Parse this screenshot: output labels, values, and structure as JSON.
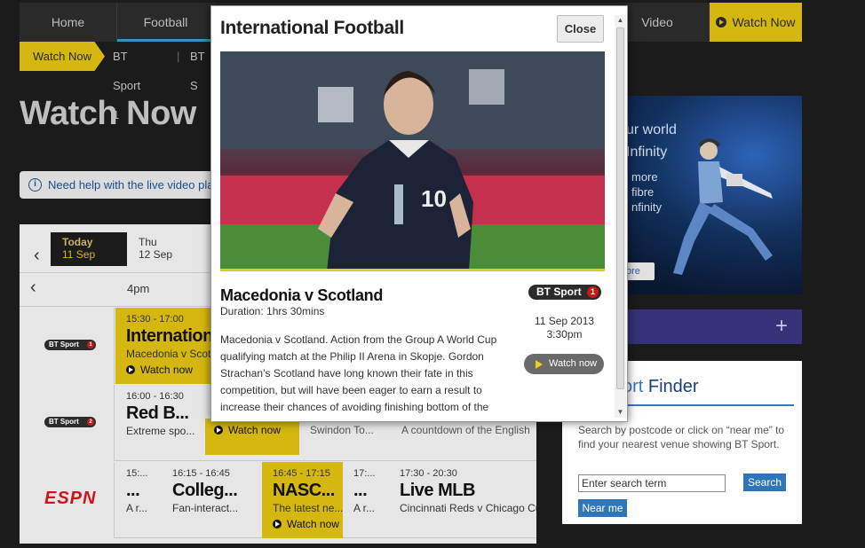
{
  "nav": {
    "items": [
      "Home",
      "Football",
      "Video"
    ],
    "watch_now": "Watch Now"
  },
  "subnav": {
    "tag": "Watch Now",
    "links": [
      "BT Sport 1",
      "BT S"
    ]
  },
  "page_title": "Watch Now",
  "help_text": "Need help with the live video pla",
  "schedule": {
    "today": {
      "day": "Today",
      "date": "11 Sep"
    },
    "next": {
      "day": "Thu",
      "date": "12 Sep"
    },
    "time_label": "4pm",
    "rows": [
      {
        "channel": "BT Sport 1",
        "programmes": [
          {
            "time": "15:30 - 17:00",
            "title": "Internation",
            "desc": "Macedonia v Scotla",
            "watch": "Watch now"
          }
        ]
      },
      {
        "channel": "BT Sport 2",
        "programmes": [
          {
            "time": "16:00 - 16:30",
            "title": "Red B...",
            "desc": "Extreme spo...",
            "watch": ""
          },
          {
            "time": "",
            "title": "",
            "desc": "",
            "watch": "Watch now"
          },
          {
            "time": "",
            "title": "",
            "desc": "Swindon To...",
            "watch": ""
          },
          {
            "time": "",
            "title": "",
            "desc": "A countdown of the English",
            "watch": ""
          }
        ]
      },
      {
        "channel": "ESPN",
        "programmes": [
          {
            "time": "15:...",
            "title": "...",
            "desc": "A r...",
            "watch": ""
          },
          {
            "time": "16:15 - 16:45",
            "title": "Colleg...",
            "desc": "Fan-interact...",
            "watch": ""
          },
          {
            "time": "16:45 - 17:15",
            "title": "NASC...",
            "desc": "The latest ne...",
            "watch": "Watch now"
          },
          {
            "time": "17:...",
            "title": "...",
            "desc": "A r...",
            "watch": ""
          },
          {
            "time": "17:30 - 20:30",
            "title": "Live MLB",
            "desc": "Cincinnati Reds v Chicago Cu",
            "watch": ""
          }
        ]
      }
    ]
  },
  "ad": {
    "line1": "ur world",
    "line2": "Infinity",
    "line3": "more",
    "line4": "fibre",
    "line5": "nfinity",
    "more": "ore"
  },
  "finder": {
    "title_part1": "ort",
    "title_part2": " Finder",
    "text": "Search by postcode or click on “near me” to find your nearest venue showing BT Sport.",
    "input_value": "Enter search term",
    "search_label": "Search",
    "nearme_label": "Near me"
  },
  "modal": {
    "title": "International Football",
    "close_label": "Close",
    "match_title": "Macedonia v Scotland",
    "duration": "Duration: 1hrs 30mins",
    "channel": "BT Sport",
    "channel_num": "1",
    "date": "11 Sep 2013",
    "time": "3:30pm",
    "watch_label": "Watch now",
    "description": "Macedonia v Scotland. Action from the Group A World Cup qualifying match at the Philip II Arena in Skopje. Gordon Strachan’s Scotland have long known their fate in this competition, but will have been eager to earn a result to increase their chances of avoiding finishing bottom of the table.",
    "player_shirt_number": "10"
  },
  "colors": {
    "accent_yellow": "#d6b70f",
    "nav_bg": "#2a2a2a",
    "link_blue": "#2f75b9",
    "purple": "#37317a"
  }
}
